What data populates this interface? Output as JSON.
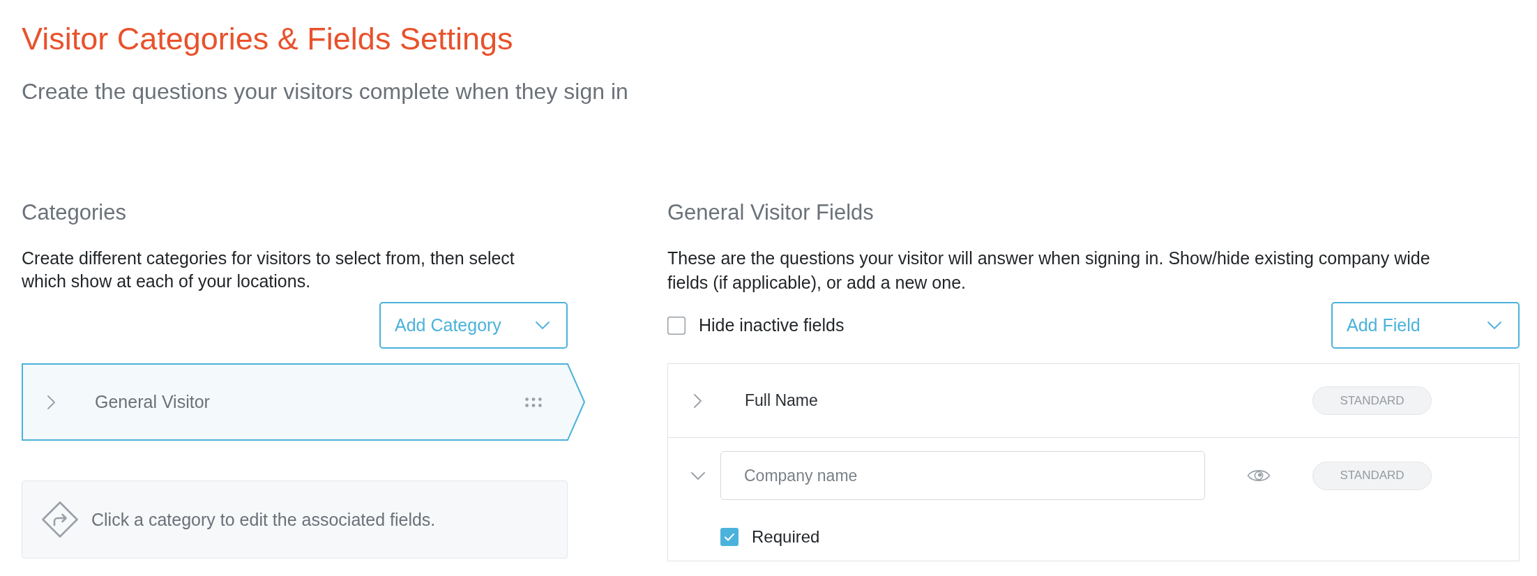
{
  "page": {
    "title": "Visitor Categories & Fields Settings",
    "subtitle": "Create the questions your visitors complete when they sign in"
  },
  "categories": {
    "heading": "Categories",
    "description": "Create different categories for visitors to select from, then select which show at each of your locations.",
    "add_button": "Add Category",
    "items": [
      {
        "name": "General Visitor",
        "selected": true,
        "expanded": false
      }
    ],
    "hint": "Click a category to edit the associated fields."
  },
  "fields": {
    "heading": "General Visitor Fields",
    "description": "These are the questions your visitor will answer when signing in. Show/hide existing company wide fields (if applicable), or add a new one.",
    "hide_inactive": {
      "label": "Hide inactive fields",
      "checked": false
    },
    "add_button": "Add Field",
    "items": [
      {
        "name": "Full Name",
        "expanded": false,
        "badge": "STANDARD"
      },
      {
        "placeholder": "Company name",
        "expanded": true,
        "badge": "STANDARD",
        "required": {
          "label": "Required",
          "checked": true
        }
      }
    ]
  }
}
